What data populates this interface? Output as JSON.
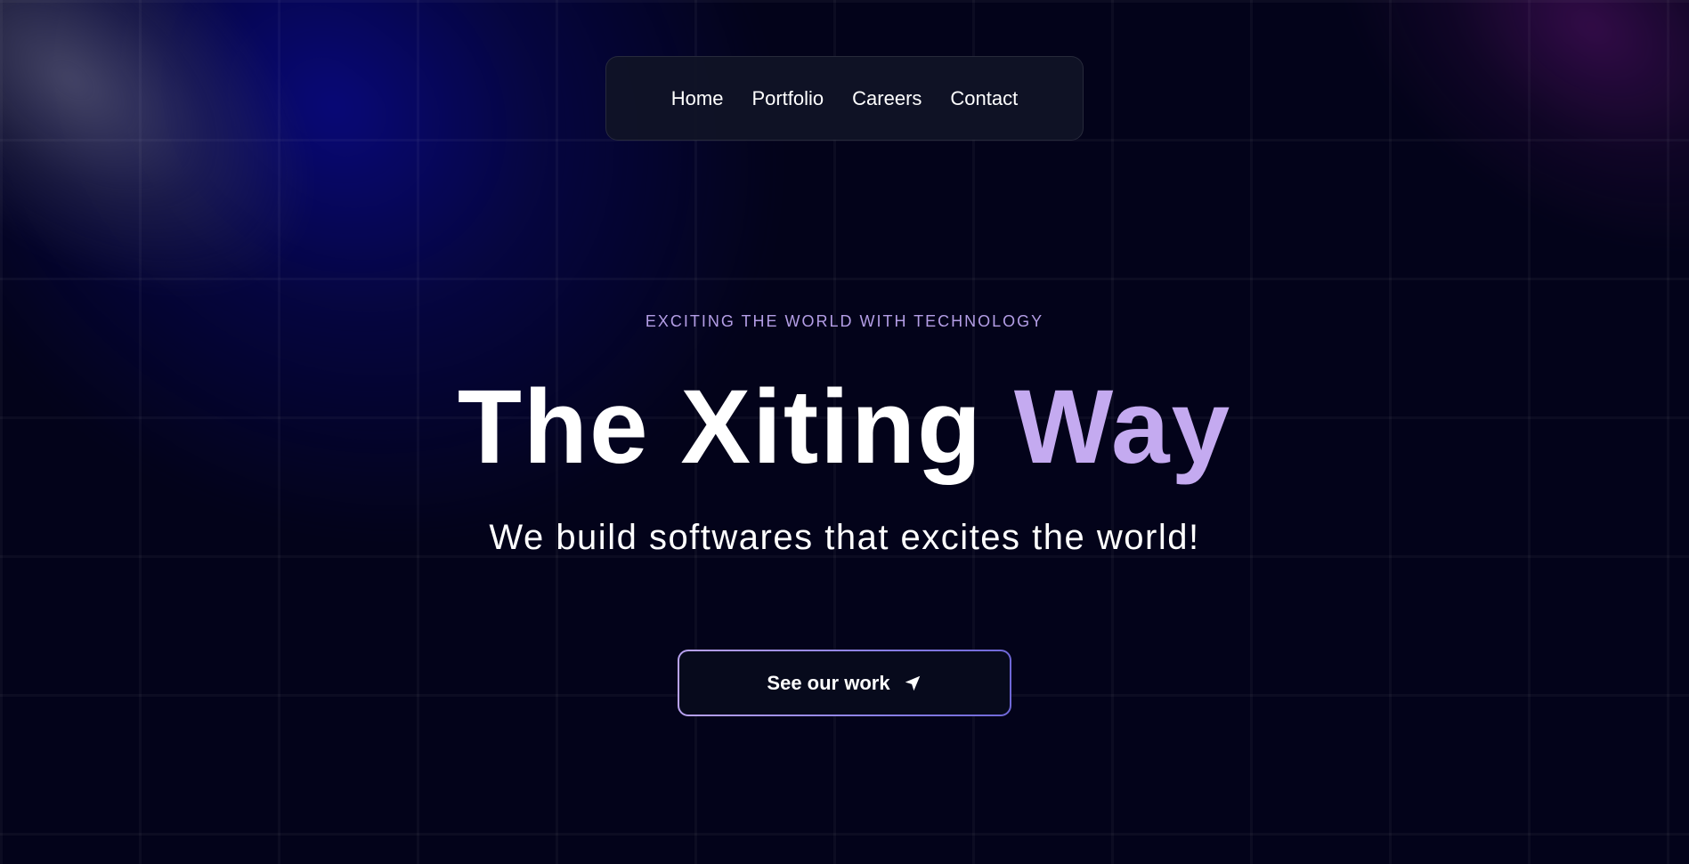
{
  "nav": {
    "items": [
      {
        "label": "Home"
      },
      {
        "label": "Portfolio"
      },
      {
        "label": "Careers"
      },
      {
        "label": "Contact"
      }
    ]
  },
  "hero": {
    "eyebrow": "EXCITING THE WORLD WITH TECHNOLOGY",
    "title_main": "The Xiting ",
    "title_accent": "Way",
    "subtitle": "We build softwares that excites the world!"
  },
  "cta": {
    "label": "See our work",
    "icon": "navigation-arrow-icon"
  },
  "colors": {
    "background": "#03031a",
    "accent": "#c4aaf0",
    "eyebrow": "#b49ee6",
    "nav_background": "#101426"
  }
}
